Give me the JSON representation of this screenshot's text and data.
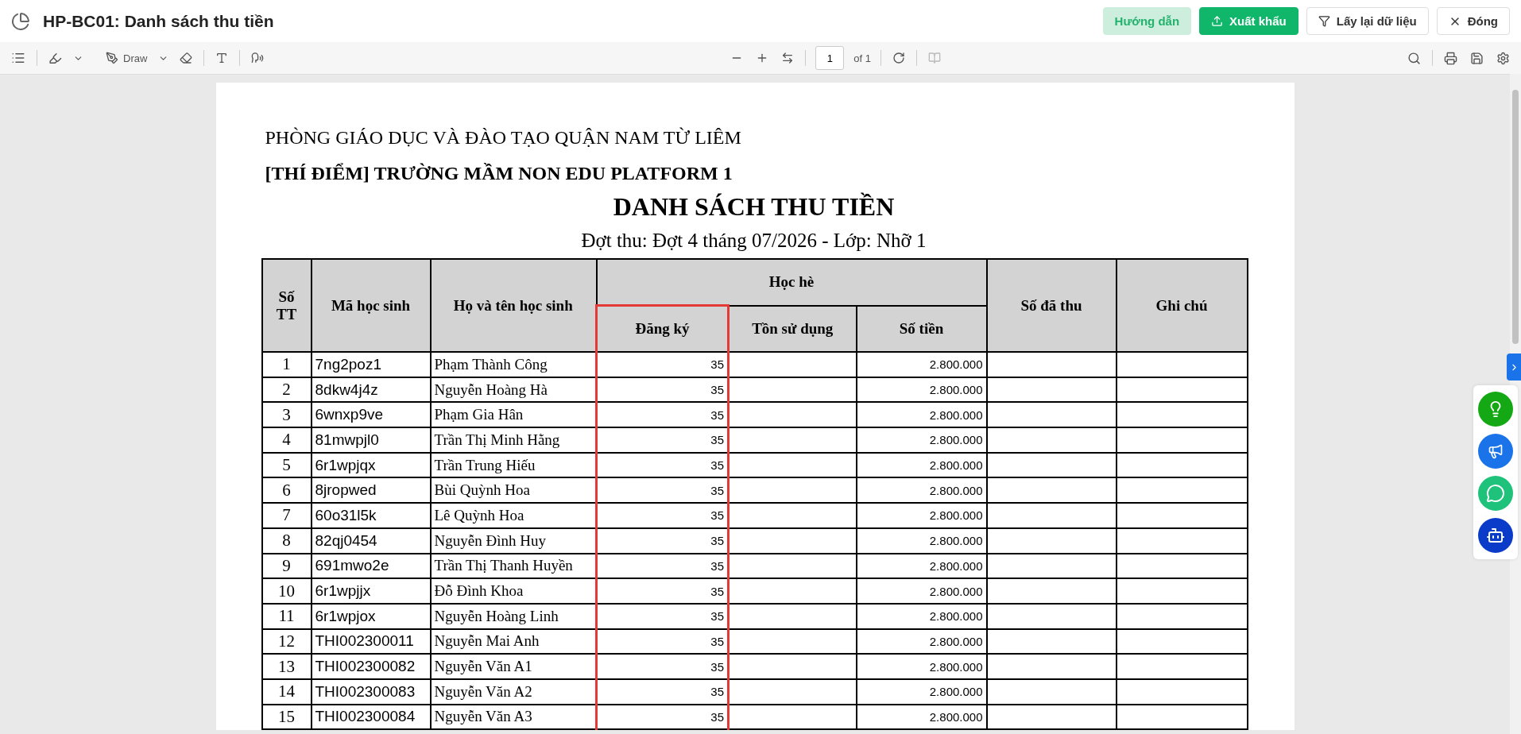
{
  "header": {
    "title": "HP-BC01: Danh sách thu tiền",
    "buttons": [
      {
        "label": "Hướng dẫn",
        "kind": "soft"
      },
      {
        "label": "Xuất khẩu",
        "kind": "primary"
      },
      {
        "label": "Lấy lại dữ liệu",
        "kind": "filter"
      },
      {
        "label": "Đóng",
        "kind": "close"
      }
    ]
  },
  "toolbar": {
    "draw_label": "Draw",
    "page_number": "1",
    "page_total": "of 1"
  },
  "document": {
    "lines": [
      {
        "text": "PHÒNG GIÁO DỤC VÀ ĐÀO TẠO QUẬN NAM TỪ LIÊM",
        "kind": "org"
      },
      {
        "text": "[THÍ ĐIỂM] TRƯỜNG MẦM NON EDU PLATFORM 1",
        "kind": "school"
      },
      {
        "text": "DANH SÁCH THU TIỀN",
        "kind": "title"
      },
      {
        "text": "Đợt thu: Đợt 4 tháng 07/2026 - Lớp: Nhỡ 1",
        "kind": "subtitle"
      }
    ],
    "table": {
      "group_header": "Học hè",
      "columns": [
        {
          "label": "Số TT",
          "in_group": false,
          "highlighted": false
        },
        {
          "label": "Mã học sinh",
          "in_group": false,
          "highlighted": false
        },
        {
          "label": "Họ và tên học sinh",
          "in_group": false,
          "highlighted": false
        },
        {
          "label": "Đăng ký",
          "in_group": true,
          "highlighted": true
        },
        {
          "label": "Tồn sử dụng",
          "in_group": true,
          "highlighted": false
        },
        {
          "label": "Số tiền",
          "in_group": true,
          "highlighted": false
        },
        {
          "label": "Số đã thu",
          "in_group": false,
          "highlighted": false
        },
        {
          "label": "Ghi chú",
          "in_group": false,
          "highlighted": false
        }
      ],
      "rows": [
        {
          "no": "1",
          "code": "7ng2poz1",
          "name": "Phạm Thành Công",
          "registered": "35",
          "amount": "2.800.000"
        },
        {
          "no": "2",
          "code": "8dkw4j4z",
          "name": "Nguyễn Hoàng Hà",
          "registered": "35",
          "amount": "2.800.000"
        },
        {
          "no": "3",
          "code": "6wnxp9ve",
          "name": "Phạm Gia Hân",
          "registered": "35",
          "amount": "2.800.000"
        },
        {
          "no": "4",
          "code": "81mwpjl0",
          "name": "Trần Thị Minh Hằng",
          "registered": "35",
          "amount": "2.800.000"
        },
        {
          "no": "5",
          "code": "6r1wpjqx",
          "name": "Trần Trung Hiếu",
          "registered": "35",
          "amount": "2.800.000"
        },
        {
          "no": "6",
          "code": "8jropwed",
          "name": "Bùi Quỳnh Hoa",
          "registered": "35",
          "amount": "2.800.000"
        },
        {
          "no": "7",
          "code": "60o31l5k",
          "name": "Lê Quỳnh Hoa",
          "registered": "35",
          "amount": "2.800.000"
        },
        {
          "no": "8",
          "code": "82qj0454",
          "name": "Nguyễn Đình Huy",
          "registered": "35",
          "amount": "2.800.000"
        },
        {
          "no": "9",
          "code": "691mwo2e",
          "name": "Trần Thị Thanh Huyền",
          "registered": "35",
          "amount": "2.800.000"
        },
        {
          "no": "10",
          "code": "6r1wpjjx",
          "name": "Đỗ Đình Khoa",
          "registered": "35",
          "amount": "2.800.000"
        },
        {
          "no": "11",
          "code": "6r1wpjox",
          "name": "Nguyễn Hoàng Linh",
          "registered": "35",
          "amount": "2.800.000"
        },
        {
          "no": "12",
          "code": "THI002300011",
          "name": "Nguyễn Mai Anh",
          "registered": "35",
          "amount": "2.800.000"
        },
        {
          "no": "13",
          "code": "THI002300082",
          "name": "Nguyễn Văn A1",
          "registered": "35",
          "amount": "2.800.000"
        },
        {
          "no": "14",
          "code": "THI002300083",
          "name": "Nguyễn Văn A2",
          "registered": "35",
          "amount": "2.800.000"
        },
        {
          "no": "15",
          "code": "THI002300084",
          "name": "Nguyễn Văn A3",
          "registered": "35",
          "amount": "2.800.000"
        }
      ]
    }
  }
}
